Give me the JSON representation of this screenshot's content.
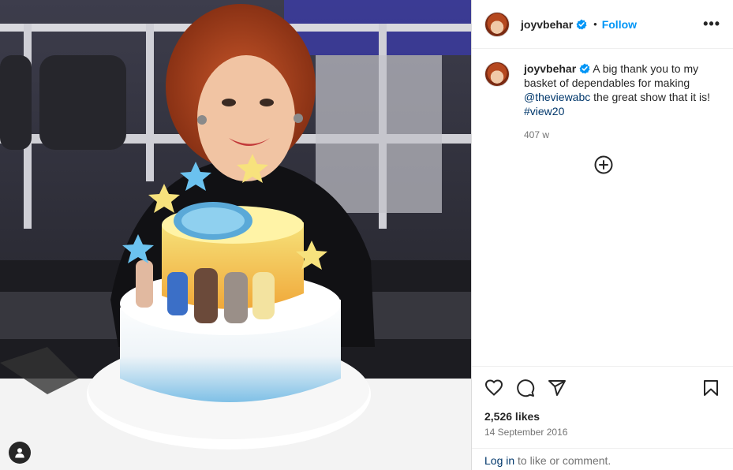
{
  "post": {
    "photo_alt_icon": "user-tag-icon"
  },
  "header": {
    "username": "joyvbehar",
    "dot": "•",
    "follow_label": "Follow",
    "more_label": "•••"
  },
  "caption": {
    "username": "joyvbehar",
    "text_before": " A big thank you to my basket of dependables for making ",
    "mention": "@theviewabc",
    "text_after": " the great show that it is! ",
    "hashtag": "#view20",
    "age": "407 w"
  },
  "actions": {
    "like_icon": "heart-icon",
    "comment_icon": "comment-icon",
    "share_icon": "share-icon",
    "save_icon": "bookmark-icon"
  },
  "stats": {
    "likes": "2,526 likes",
    "date": "14 September 2016"
  },
  "footer": {
    "login_label": "Log in",
    "login_suffix": " to like or comment."
  },
  "colors": {
    "accent": "#0095f6",
    "link": "#00376b",
    "verified": "#0095f6",
    "muted": "#737373"
  }
}
